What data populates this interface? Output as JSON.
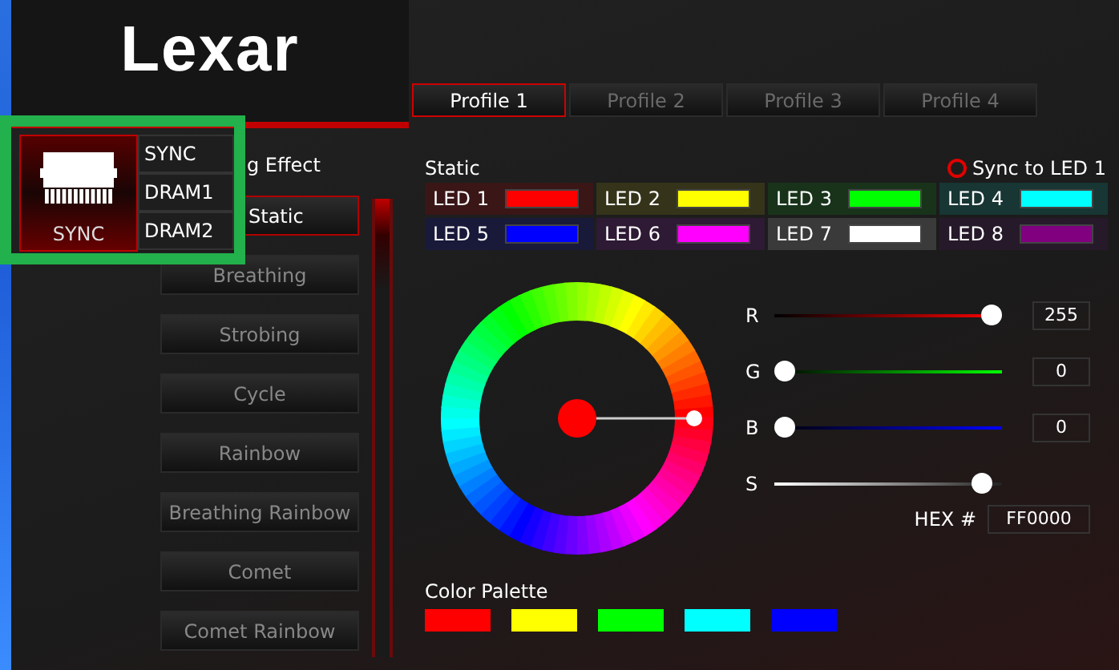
{
  "logo": "Lexar",
  "profiles": [
    {
      "label": "Profile 1",
      "selected": true
    },
    {
      "label": "Profile 2",
      "selected": false
    },
    {
      "label": "Profile 3",
      "selected": false
    },
    {
      "label": "Profile 4",
      "selected": false
    }
  ],
  "device_menu": {
    "tile": {
      "label": "SYNC",
      "selected": true
    },
    "items": [
      "SYNC",
      "DRAM1",
      "DRAM2"
    ]
  },
  "effects_heading": "g Effect",
  "effects": [
    {
      "label": "Static",
      "selected": true
    },
    {
      "label": "Breathing",
      "selected": false
    },
    {
      "label": "Strobing",
      "selected": false
    },
    {
      "label": "Cycle",
      "selected": false
    },
    {
      "label": "Rainbow",
      "selected": false
    },
    {
      "label": "Breathing Rainbow",
      "selected": false
    },
    {
      "label": "Comet",
      "selected": false
    },
    {
      "label": "Comet Rainbow",
      "selected": false
    }
  ],
  "mode_title": "Static",
  "sync_to_led1": {
    "label": "Sync to LED 1",
    "checked": false
  },
  "leds": [
    {
      "label": "LED 1",
      "color": "#ff0000"
    },
    {
      "label": "LED 2",
      "color": "#ffff00"
    },
    {
      "label": "LED 3",
      "color": "#00ff00"
    },
    {
      "label": "LED 4",
      "color": "#00ffff"
    },
    {
      "label": "LED 5",
      "color": "#0000ff"
    },
    {
      "label": "LED 6",
      "color": "#ff00ff"
    },
    {
      "label": "LED 7",
      "color": "#ffffff"
    },
    {
      "label": "LED 8",
      "color": "#800080"
    }
  ],
  "wheel": {
    "color": "#ff0000"
  },
  "sliders": [
    {
      "label": "R",
      "kind": "red",
      "level": 1,
      "value": "255"
    },
    {
      "label": "G",
      "kind": "green",
      "level": 0,
      "value": "0"
    },
    {
      "label": "B",
      "kind": "blue",
      "level": 0,
      "value": "0"
    },
    {
      "label": "S",
      "kind": "saturation",
      "level": 0.95
    }
  ],
  "hex": {
    "label": "HEX #",
    "value": "FF0000"
  },
  "palette": {
    "label": "Color Palette",
    "colors": [
      {
        "color": "#ff0000"
      },
      {
        "color": "#ffff00"
      },
      {
        "color": "#00ff00"
      },
      {
        "color": "#00ffff"
      },
      {
        "color": "#0000ff"
      }
    ]
  }
}
